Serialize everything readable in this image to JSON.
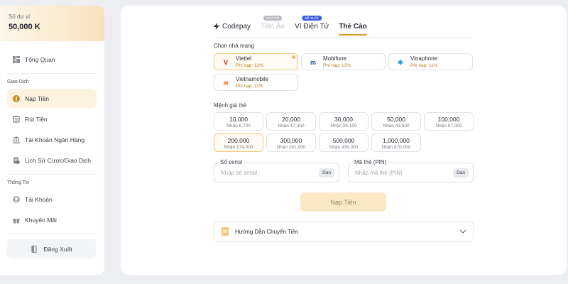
{
  "sidebar": {
    "balance_label": "Số dư ví",
    "balance_value": "50,000 K",
    "overview": "Tổng Quan",
    "section_transactions": "Giao Dịch",
    "deposit": "Nạp Tiền",
    "withdraw": "Rút Tiền",
    "bank_account": "Tài Khoản Ngân Hàng",
    "history": "Lịch Sử Cược/Giao Dịch",
    "section_info": "Thông Tin",
    "account": "Tài Khoản",
    "promotions": "Khuyến Mãi",
    "logout": "Đăng Xuất"
  },
  "tabs": [
    {
      "label": "Codepay",
      "state": "normal"
    },
    {
      "label": "Tiền Ảo",
      "state": "disabled",
      "badge": "BẢO TRÌ"
    },
    {
      "label": "Ví Điện Tử",
      "state": "normal",
      "badge": "ĐỀ XUẤT"
    },
    {
      "label": "Thẻ Cào",
      "state": "active"
    }
  ],
  "network_label": "Chọn nhà mạng",
  "networks": [
    {
      "name": "Viettel",
      "fee": "Phí nạp: 12%",
      "selected": true
    },
    {
      "name": "Mobifone",
      "fee": "Phí nạp: 13%"
    },
    {
      "name": "Vinaphone",
      "fee": "Phí nạp: 11%"
    },
    {
      "name": "Vietnamobile",
      "fee": "Phí nạp: 11%"
    }
  ],
  "amount_label": "Mệnh giá thẻ",
  "amounts": [
    {
      "value": "10,000",
      "receive": "Nhận 8,700"
    },
    {
      "value": "20,000",
      "receive": "Nhận 17,400"
    },
    {
      "value": "30,000",
      "receive": "Nhận 26,100"
    },
    {
      "value": "50,000",
      "receive": "Nhận 43,500"
    },
    {
      "value": "100,000",
      "receive": "Nhận 87,000"
    },
    {
      "value": "200,000",
      "receive": "Nhận 174,000",
      "selected": true
    },
    {
      "value": "300,000",
      "receive": "Nhận 261,000"
    },
    {
      "value": "500,000",
      "receive": "Nhận 435,000"
    },
    {
      "value": "1,000,000",
      "receive": "Nhận 870,000"
    }
  ],
  "serial": {
    "label": "Số serial",
    "placeholder": "Nhập số serial",
    "value": "",
    "paste": "Dán"
  },
  "pin": {
    "label": "Mã thẻ (PIN)",
    "placeholder": "Nhập mã thẻ (PIN)",
    "value": "",
    "paste": "Dán"
  },
  "submit_label": "Nạp Tiền",
  "guide_label": "Hướng Dẫn Chuyển Tiền",
  "colors": {
    "accent": "#d89a2e",
    "selected_bg": "#fffbf3",
    "selected_border": "#f0c97d",
    "fee_text": "#b87a1a",
    "submit_bg": "#fbe9c6"
  }
}
